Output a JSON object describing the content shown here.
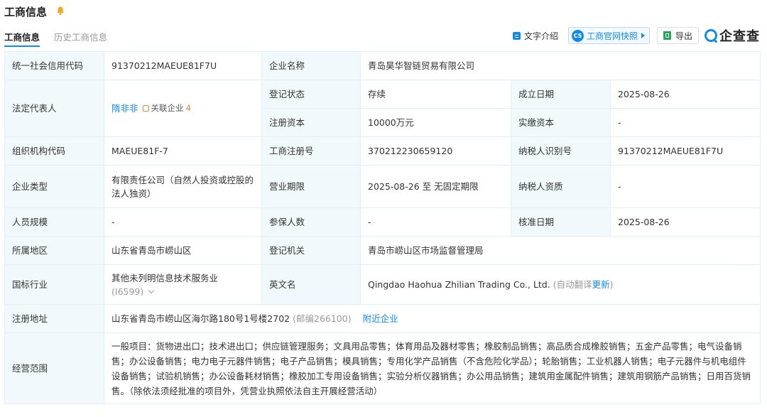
{
  "header": {
    "title": "工商信息",
    "tabs": [
      {
        "label": "工商信息",
        "active": true
      },
      {
        "label": "历史工商信息",
        "active": false
      }
    ],
    "toolbar": {
      "text_intro": "文字介绍",
      "snapshot": "工商官网快照",
      "snapshot_logo": "CS",
      "export": "导出",
      "brand": "企查查"
    }
  },
  "colors": {
    "accent": "#128bed",
    "key_bg": "#f2f9fc",
    "border": "#e4eef6",
    "orange": "#f0883a",
    "green": "#26a65b"
  },
  "table": {
    "credit_code_label": "统一社会信用代码",
    "credit_code": "91370212MAEUE81F7U",
    "company_name_label": "企业名称",
    "company_name": "青岛昊华智链贸易有限公司",
    "legal_rep_label": "法定代表人",
    "legal_rep": "隋非非",
    "related_label": "关联企业",
    "related_count": "4",
    "reg_status_label": "登记状态",
    "reg_status": "存续",
    "founded_label": "成立日期",
    "founded": "2025-08-26",
    "reg_capital_label": "注册资本",
    "reg_capital": "10000万元",
    "paid_capital_label": "实缴资本",
    "paid_capital": "-",
    "org_code_label": "组织机构代码",
    "org_code": "MAEUE81F-7",
    "reg_no_label": "工商注册号",
    "reg_no": "370212230659120",
    "taxpayer_id_label": "纳税人识别号",
    "taxpayer_id": "91370212MAEUE81F7U",
    "type_label": "企业类型",
    "type": "有限责任公司（自然人投资或控股的法人独资）",
    "term_label": "营业期限",
    "term": "2025-08-26 至 无固定期限",
    "taxpayer_qual_label": "纳税人资质",
    "taxpayer_qual": "-",
    "staff_label": "人员规模",
    "staff": "-",
    "insured_label": "参保人数",
    "insured": "-",
    "approved_label": "核准日期",
    "approved": "2025-08-26",
    "region_label": "所属地区",
    "region": "山东省青岛市崂山区",
    "authority_label": "登记机关",
    "authority": "青岛市崂山区市场监督管理局",
    "industry_label": "国标行业",
    "industry": "其他未列明信息技术服务业",
    "industry_code": "(I6599)",
    "english_name_label": "英文名",
    "english_name": "Qingdao Haohua Zhilian Trading Co., Ltd.",
    "auto_translate": "(自动翻译",
    "update": "更新",
    "close_paren": ")",
    "address_label": "注册地址",
    "address": "山东省青岛市崂山区海尔路180号1号楼2702",
    "postcode": "(邮编266100)",
    "nearby": "附近企业",
    "scope_label": "经营范围",
    "scope": "一般项目：货物进出口；技术进出口；供应链管理服务；文具用品零售；体育用品及器材零售；橡胶制品销售；高品质合成橡胶销售；五金产品零售；电气设备销售；办公设备销售；电力电子元器件销售；电子产品销售；模具销售；专用化学产品销售（不含危险化学品）；轮胎销售；工业机器人销售；电子元器件与机电组件设备销售；试验机销售；办公设备耗材销售；橡胶加工专用设备销售；实验分析仪器销售；办公用品销售；建筑用金属配件销售；建筑用钢筋产品销售；日用百货销售。（除依法须经批准的项目外，凭营业执照依法自主开展经营活动）"
  }
}
